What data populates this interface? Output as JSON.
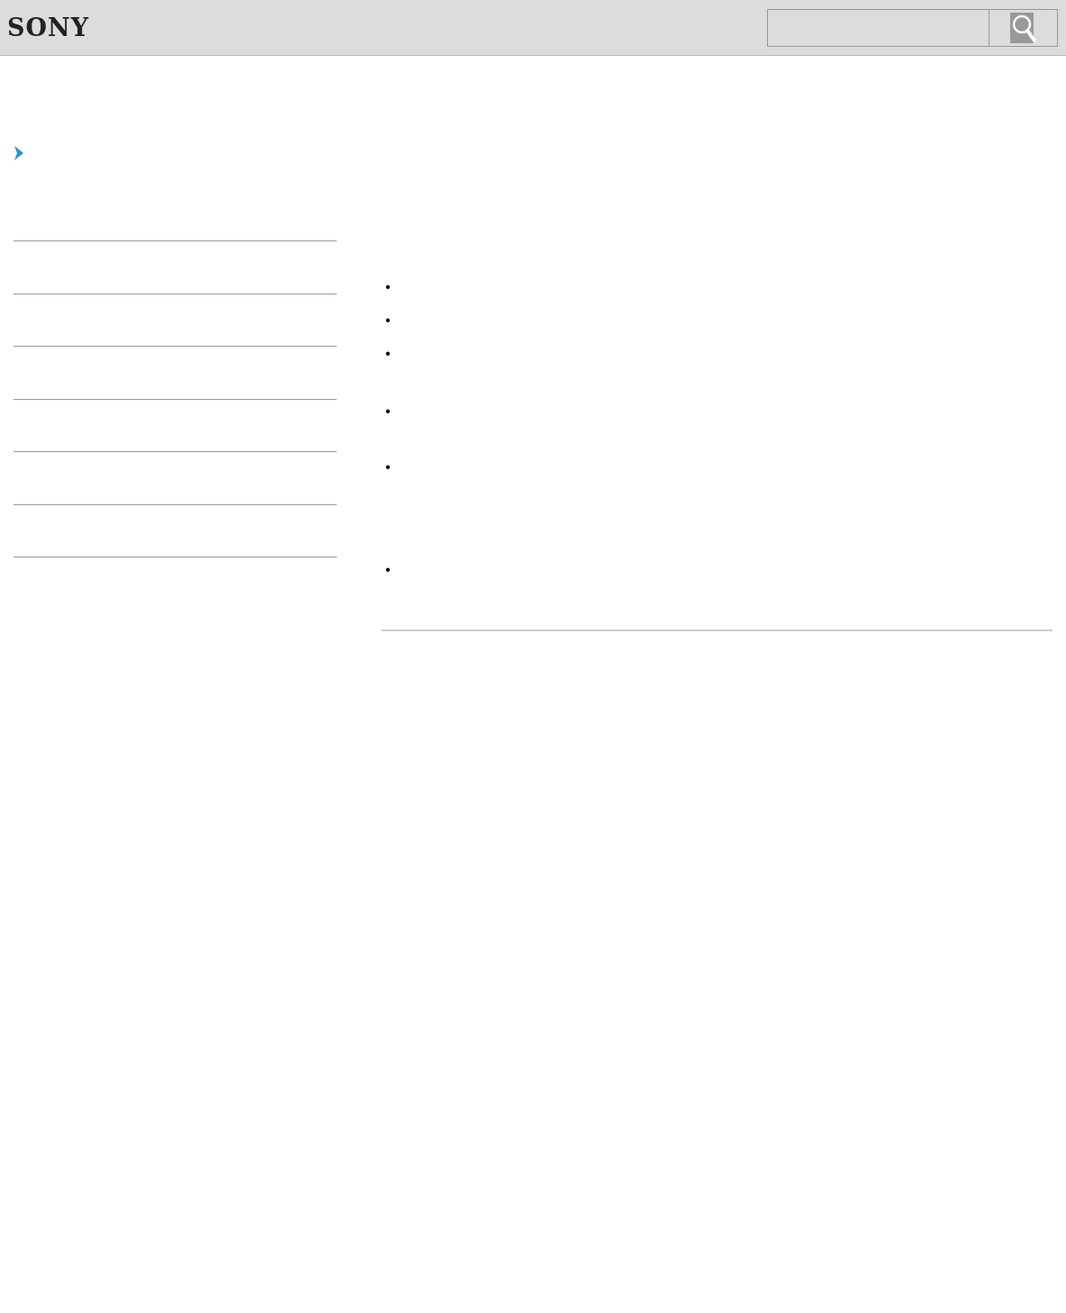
{
  "header": {
    "logo": "SONY",
    "search": {
      "button": {
        "kind": "search"
      }
    }
  },
  "bullets": [
    "•",
    "•",
    "•",
    "•",
    "•",
    "•"
  ]
}
